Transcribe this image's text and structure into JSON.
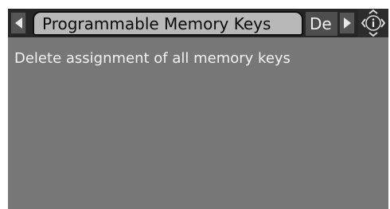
{
  "tabbar": {
    "active_tab": "Programmable Memory Keys",
    "next_tab": "De",
    "prev_icon": "triangle-left-icon",
    "next_icon": "triangle-right-icon",
    "info_icon": "info-diamond-icon"
  },
  "content": {
    "items": [
      "Delete assignment of all memory keys"
    ]
  },
  "colors": {
    "screen_background": "#777777",
    "tabbar_background": "#262626",
    "active_tab_background": "#b8b8b8",
    "text": "#f2f2f2"
  }
}
